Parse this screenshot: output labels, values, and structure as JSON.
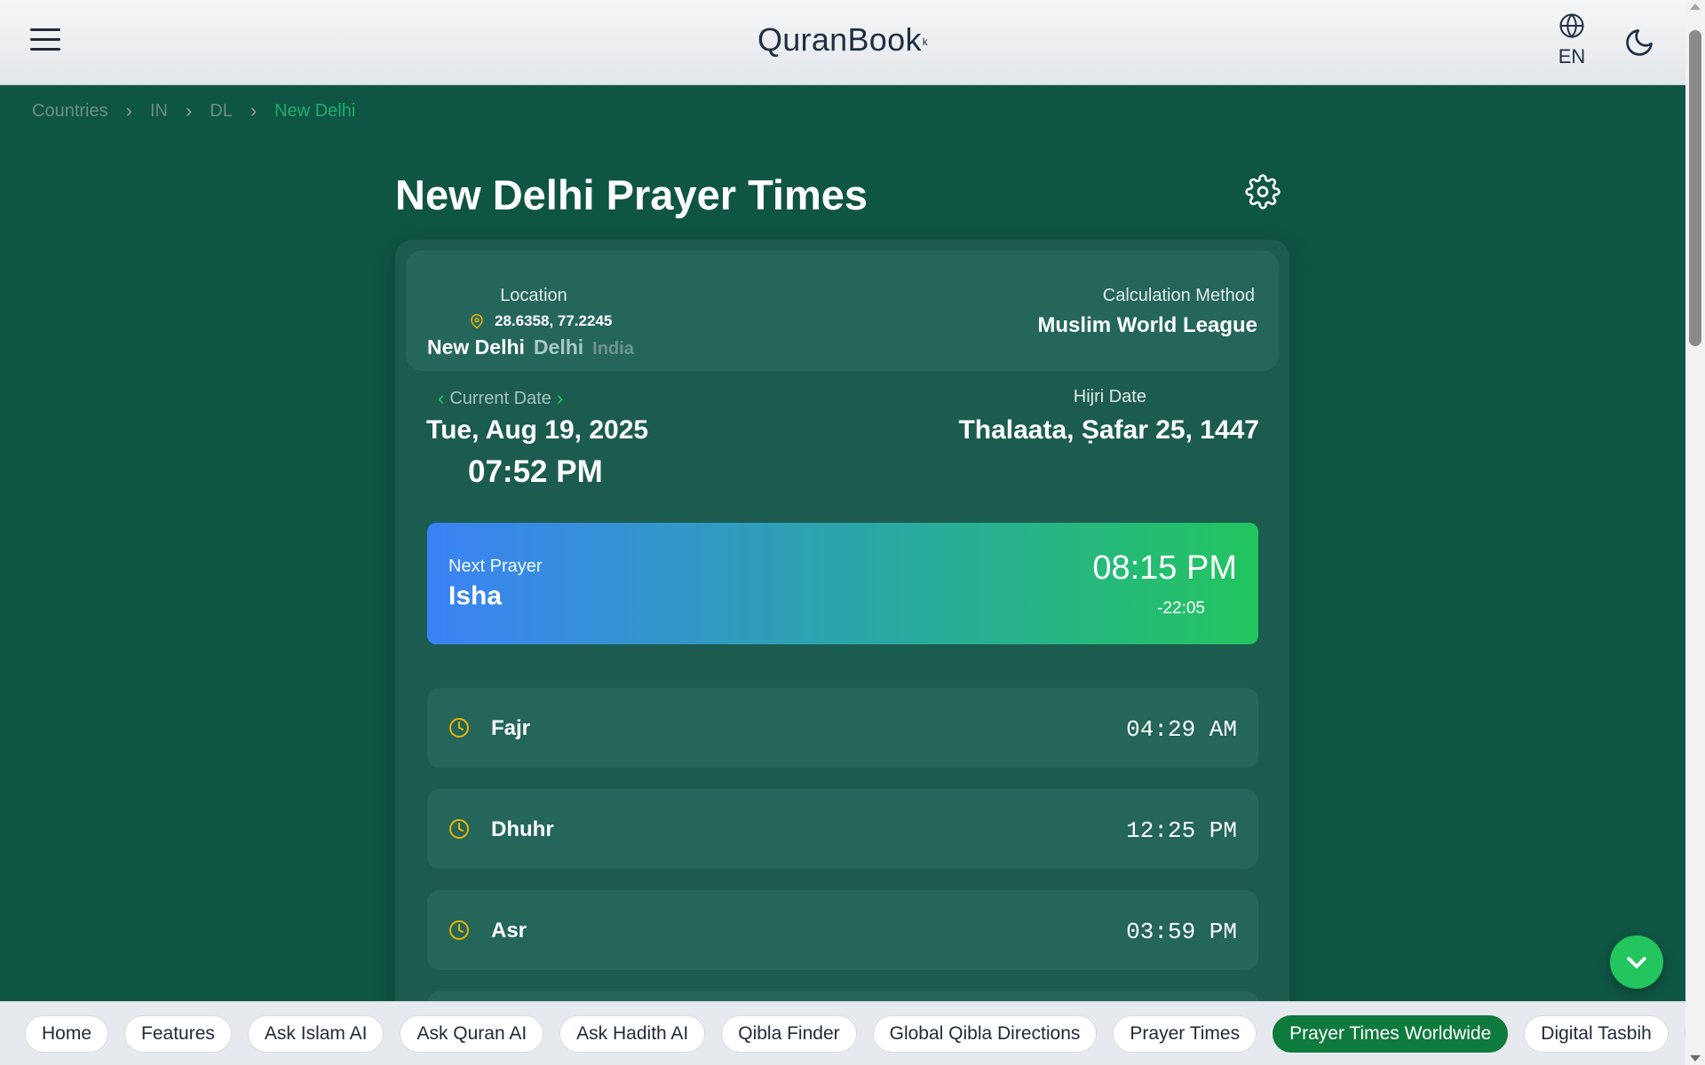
{
  "header": {
    "brand": "QuranBook",
    "brand_mark": "k",
    "language": "EN"
  },
  "breadcrumb": {
    "items": [
      "Countries",
      "IN",
      "DL",
      "New Delhi"
    ]
  },
  "page": {
    "title": "New Delhi Prayer Times"
  },
  "location": {
    "label": "Location",
    "coordinates": "28.6358, 77.2245",
    "city": "New Delhi",
    "region": "Delhi",
    "country": "India"
  },
  "calculation": {
    "label": "Calculation Method",
    "value": "Muslim World League"
  },
  "date": {
    "label": "Current Date",
    "value": "Tue, Aug 19, 2025",
    "time": "07:52 PM"
  },
  "hijri": {
    "label": "Hijri Date",
    "value": "Thalaata, Ṣafar 25, 1447"
  },
  "next_prayer": {
    "label": "Next Prayer",
    "name": "Isha",
    "time": "08:15 PM",
    "countdown": "-22:05"
  },
  "prayers": [
    {
      "name": "Fajr",
      "time": "04:29 AM"
    },
    {
      "name": "Dhuhr",
      "time": "12:25 PM"
    },
    {
      "name": "Asr",
      "time": "03:59 PM"
    }
  ],
  "bottom_nav": {
    "items": [
      "Home",
      "Features",
      "Ask Islam AI",
      "Ask Quran AI",
      "Ask Hadith AI",
      "Qibla Finder",
      "Global Qibla Directions",
      "Prayer Times",
      "Prayer Times Worldwide",
      "Digital Tasbih"
    ],
    "active": "Prayer Times Worldwide"
  },
  "colors": {
    "background": "#0f5544",
    "card": "#1b5c4f",
    "accent_green": "#22c55e",
    "accent_blue": "#3b82f6",
    "icon_yellow": "#eab308"
  }
}
